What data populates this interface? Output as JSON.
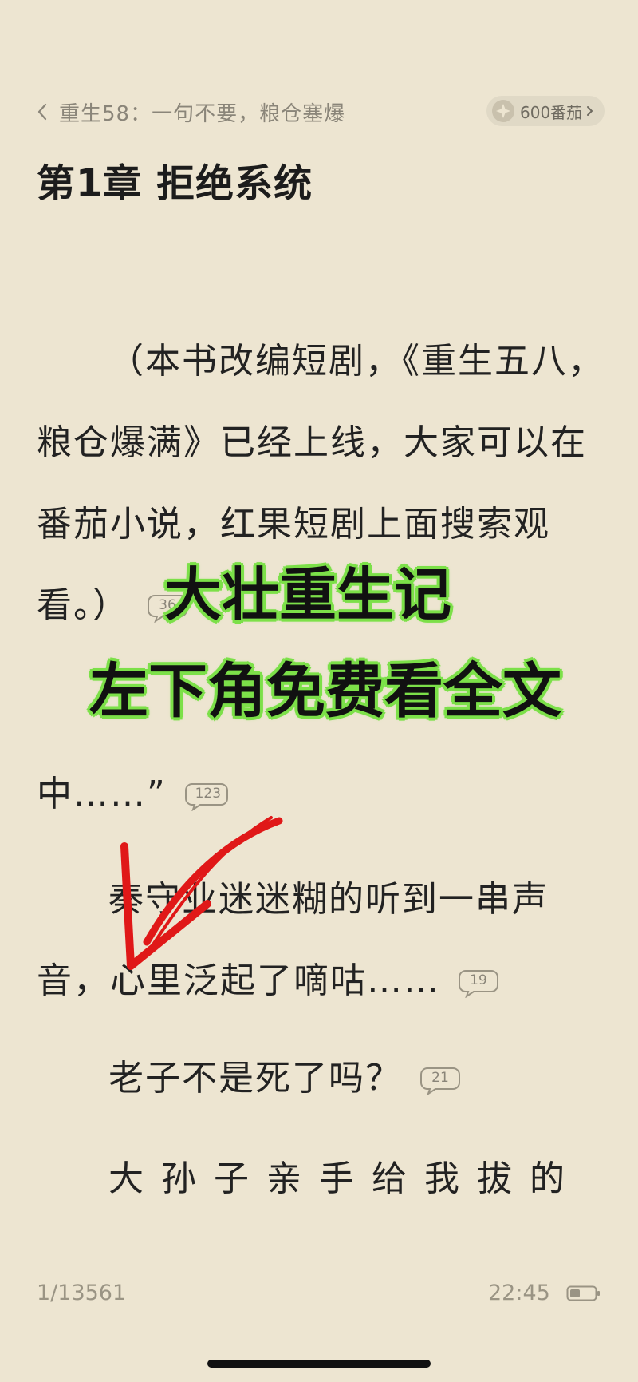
{
  "header": {
    "book_title": "重生58：一句不要，粮仓塞爆",
    "coins_label": "600番茄"
  },
  "chapter": {
    "title": "第1章 拒绝系统"
  },
  "content": {
    "lines": [
      "（本书改编短剧，《重生五八，",
      "粮仓爆满》已经上线，大家可以在",
      "番茄小说，红果短剧上面搜索观",
      "看。）",
      "中……”",
      "秦守业迷迷糊的听到一串声",
      "音，心里泛起了嘀咕……",
      "老子不是死了吗？",
      "大孙子亲手给我拔的"
    ],
    "comment_counts": [
      "36",
      "123",
      "19",
      "21"
    ]
  },
  "overlay": {
    "headline": "大壮重生记",
    "subheadline": "左下角免费看全文"
  },
  "footer": {
    "page_progress": "1/13561",
    "time": "22:45"
  },
  "colors": {
    "background": "#ede5d1",
    "overlay_green": "#7de04a",
    "arrow_red": "#e01818"
  }
}
